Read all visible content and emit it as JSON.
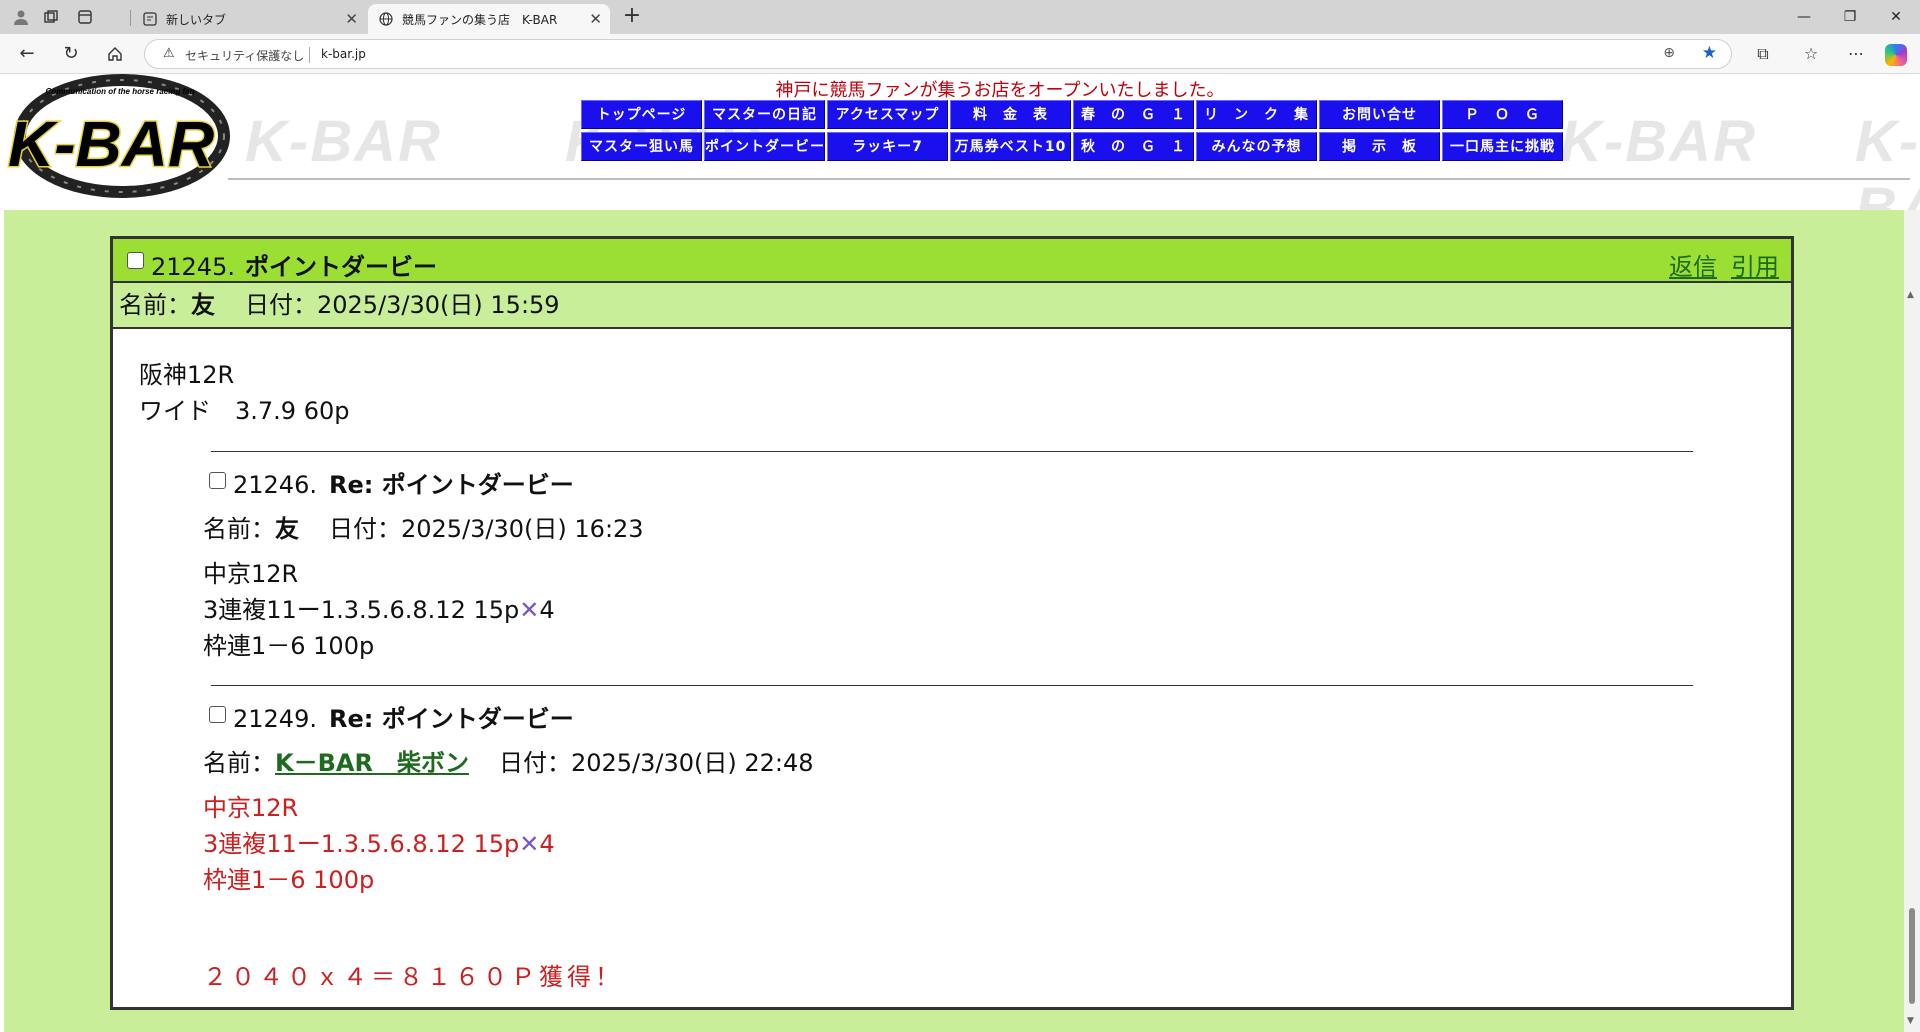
{
  "browser": {
    "tabs": [
      {
        "title": "新しいタブ",
        "icon": "newtab-icon"
      },
      {
        "title": "競馬ファンの集う店　K-BAR",
        "icon": "globe-icon"
      }
    ],
    "address": {
      "security_text": "セキュリティ保護なし",
      "url": "k-bar.jp"
    }
  },
  "site": {
    "logo_text": "K-BAR",
    "logo_subtitle": "Communication of the horse racing fan",
    "watermark": "K-BAR",
    "tagline": "神戸に競馬ファンが集うお店をオープンいたしました。",
    "menu": [
      "トップページ",
      "マスターの日記",
      "アクセスマップ",
      "料　金　表",
      "春　の　Ｇ　１",
      "リ　ン　ク　集",
      "お問い合せ",
      "Ｐ　Ｏ　Ｇ",
      "マスター狙い馬",
      "ポイントダービー",
      "ラッキー7",
      "万馬券ベスト10",
      "秋　の　Ｇ　１",
      "みんなの予想",
      "掲　示　板",
      "一口馬主に挑戦"
    ]
  },
  "post": {
    "number": "21245.",
    "title": "ポイントダービー",
    "reply_link": "返信",
    "quote_link": "引用",
    "name_label": "名前：",
    "name": "友",
    "date_label": "日付：",
    "date": "2025/3/30(日) 15:59",
    "body": [
      "阪神12R",
      "ワイド　3.7.9 60p"
    ]
  },
  "replies": [
    {
      "number": "21246.",
      "title": "Re: ポイントダービー",
      "name_label": "名前：",
      "name": "友",
      "date_label": "日付：",
      "date": "2025/3/30(日) 16:23",
      "body_line1": "中京12R",
      "body_line2_pre": "3連複11ー1.3.5.6.8.12 15p",
      "body_line2_mark": "✕",
      "body_line2_post": "4",
      "body_line3": "枠連1－6 100p"
    },
    {
      "number": "21249.",
      "title": "Re: ポイントダービー",
      "name_label": "名前：",
      "name": "K－BAR　柴ボン",
      "date_label": "日付：",
      "date": "2025/3/30(日) 22:48",
      "body_line1": "中京12R",
      "body_line2_pre": "3連複11ー1.3.5.6.8.12 15p",
      "body_line2_mark": "✕",
      "body_line2_post": "4",
      "body_line3": "枠連1－6 100p",
      "result": "２０４０ｘ４＝８１６０Ｐ獲得！"
    }
  ],
  "colors": {
    "menu_blue": "#1a10ee",
    "header_green": "#9bdf35",
    "meta_green": "#c9ee99",
    "link_green": "#1e6a1e",
    "highlight_red": "#cc1f1f",
    "tagline_red": "#c0000c"
  }
}
